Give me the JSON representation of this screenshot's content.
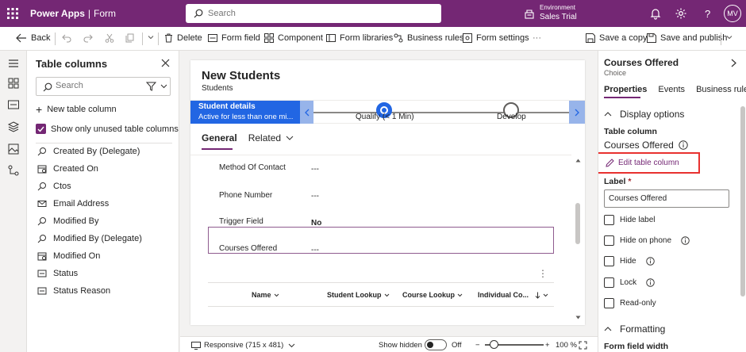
{
  "topbar": {
    "app_name": "Power Apps",
    "separator": "|",
    "section": "Form",
    "search_placeholder": "Search",
    "environment_label": "Environment",
    "environment_name": "Sales Trial",
    "avatar_initials": "MV",
    "background_color": "#742774"
  },
  "commands": {
    "back": "Back",
    "delete": "Delete",
    "form_field": "Form field",
    "component": "Component",
    "form_libraries": "Form libraries",
    "business_rules": "Business rules",
    "form_settings": "Form settings",
    "more": "···",
    "save_copy": "Save a copy",
    "save_publish": "Save and publish"
  },
  "columns_panel": {
    "title": "Table columns",
    "search_placeholder": "Search",
    "new_column": "New table column",
    "show_unused": "Show only unused table columns",
    "items": [
      {
        "label": "Created By (Delegate)",
        "icon": "lookup-icon"
      },
      {
        "label": "Created On",
        "icon": "datetime-icon"
      },
      {
        "label": "Ctos",
        "icon": "lookup-icon"
      },
      {
        "label": "Email Address",
        "icon": "email-icon"
      },
      {
        "label": "Modified By",
        "icon": "lookup-icon"
      },
      {
        "label": "Modified By (Delegate)",
        "icon": "lookup-icon"
      },
      {
        "label": "Modified On",
        "icon": "datetime-icon"
      },
      {
        "label": "Status",
        "icon": "optionset-icon"
      },
      {
        "label": "Status Reason",
        "icon": "optionset-icon"
      }
    ]
  },
  "form": {
    "title": "New Students",
    "entity": "Students",
    "bpf": {
      "active_stage": "Student details",
      "active_time": "Active for less than one mi...",
      "stages": [
        {
          "label": "Qualify  (< 1 Min)",
          "state": "current"
        },
        {
          "label": "Develop",
          "state": "upcoming"
        }
      ]
    },
    "tabs": {
      "general": "General",
      "related": "Related"
    },
    "fields": [
      {
        "label": "Method Of Contact",
        "value": "---"
      },
      {
        "label": "Phone Number",
        "value": "---"
      },
      {
        "label": "Trigger Field",
        "value": "No"
      },
      {
        "label": "Courses Offered",
        "value": "---"
      }
    ],
    "more_dots": "⋮",
    "grid_columns": [
      "Name",
      "Student Lookup",
      "Course Lookup",
      "Individual Co..."
    ]
  },
  "statusbar": {
    "responsive": "Responsive (715 x 481)",
    "show_hidden": "Show hidden",
    "toggle_state": "Off",
    "zoom": "100 %",
    "minus": "−",
    "plus": "+"
  },
  "properties": {
    "title": "Courses Offered",
    "type": "Choice",
    "tabs": [
      "Properties",
      "Events",
      "Business rules"
    ],
    "display_options": "Display options",
    "table_column_label": "Table column",
    "table_column_value": "Courses Offered",
    "edit_column": "Edit table column",
    "label_label": "Label",
    "required_mark": "*",
    "label_value": "Courses Offered",
    "checkboxes": [
      {
        "label": "Hide label",
        "info": false
      },
      {
        "label": "Hide on phone",
        "info": true
      },
      {
        "label": "Hide",
        "info": true
      },
      {
        "label": "Lock",
        "info": true
      },
      {
        "label": "Read-only",
        "info": false
      }
    ],
    "formatting": "Formatting",
    "form_field_width": "Form field width"
  }
}
